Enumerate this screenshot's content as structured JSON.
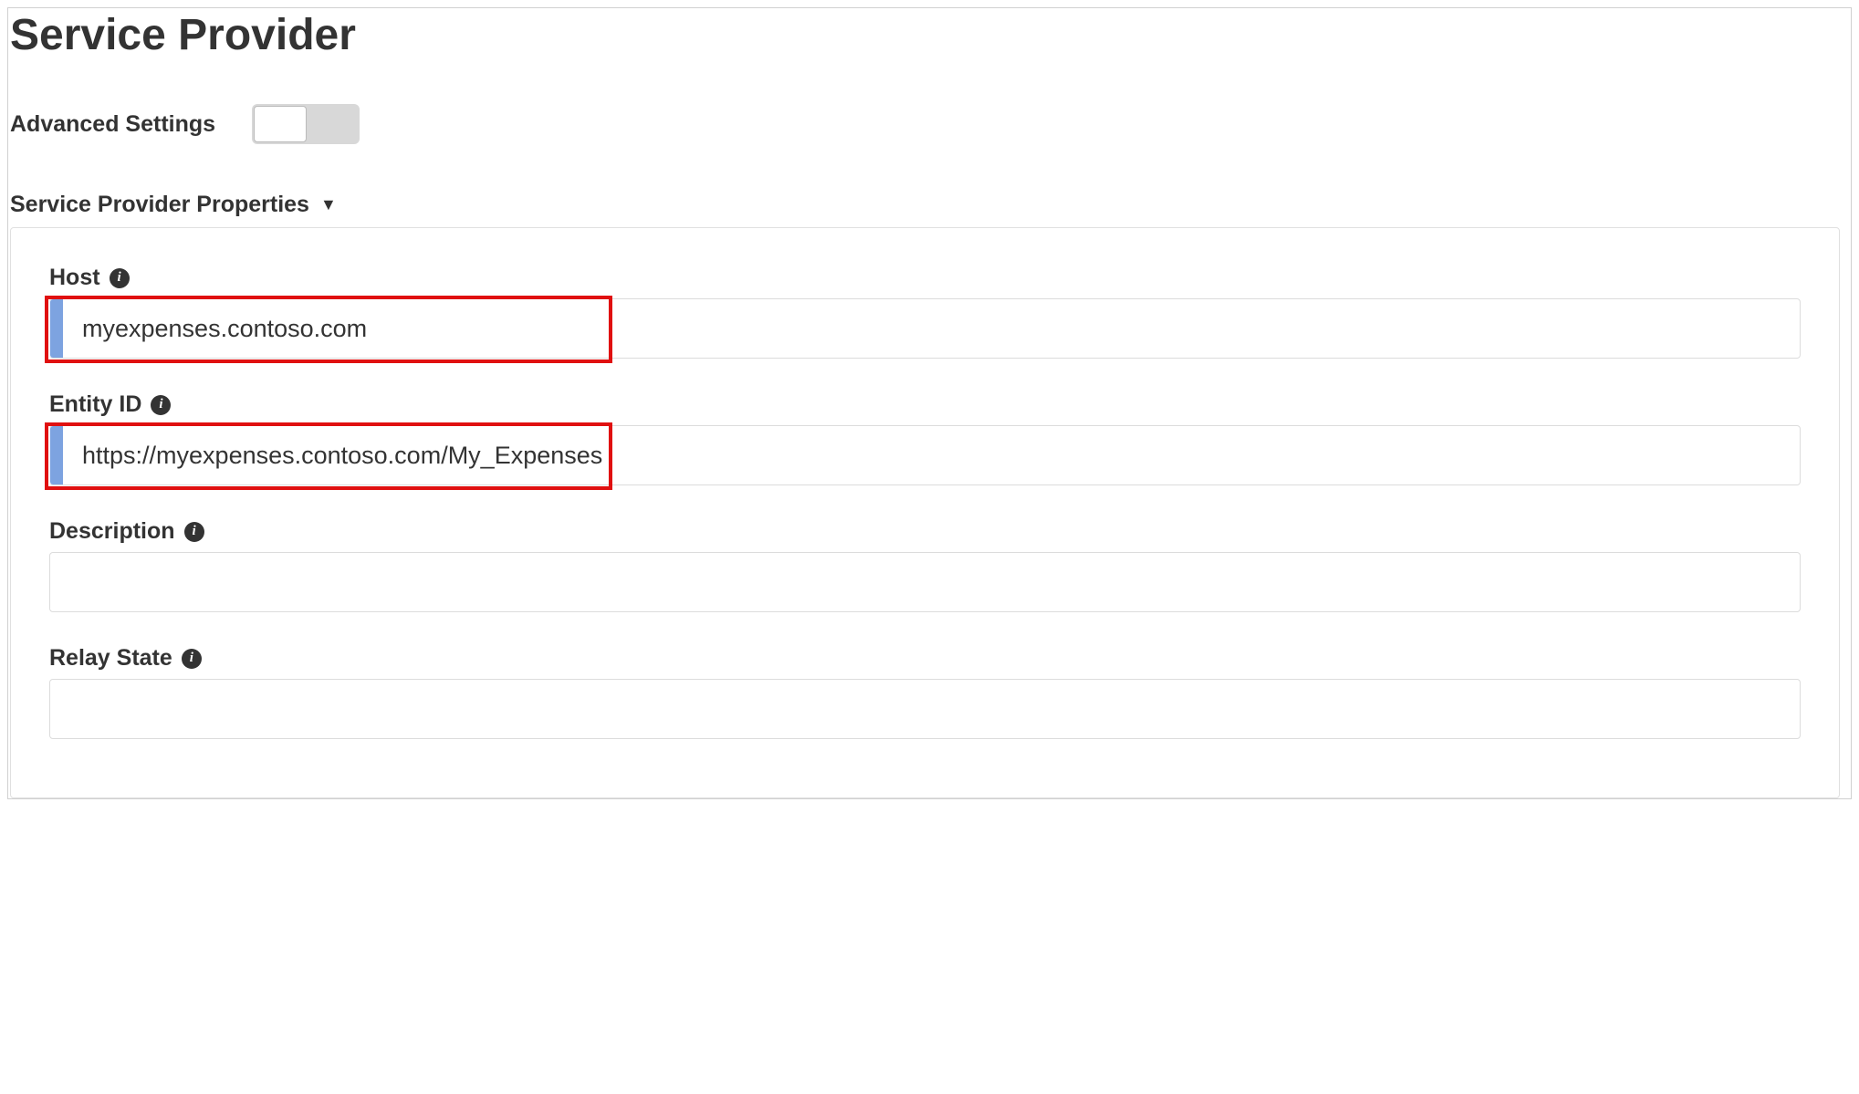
{
  "page": {
    "title": "Service Provider"
  },
  "advanced": {
    "label": "Advanced Settings",
    "enabled": false
  },
  "section": {
    "title": "Service Provider Properties"
  },
  "fields": {
    "host": {
      "label": "Host",
      "value": "myexpenses.contoso.com"
    },
    "entity_id": {
      "label": "Entity ID",
      "value": "https://myexpenses.contoso.com/My_Expenses"
    },
    "description": {
      "label": "Description",
      "value": ""
    },
    "relay_state": {
      "label": "Relay State",
      "value": ""
    }
  },
  "icons": {
    "info": "i"
  }
}
